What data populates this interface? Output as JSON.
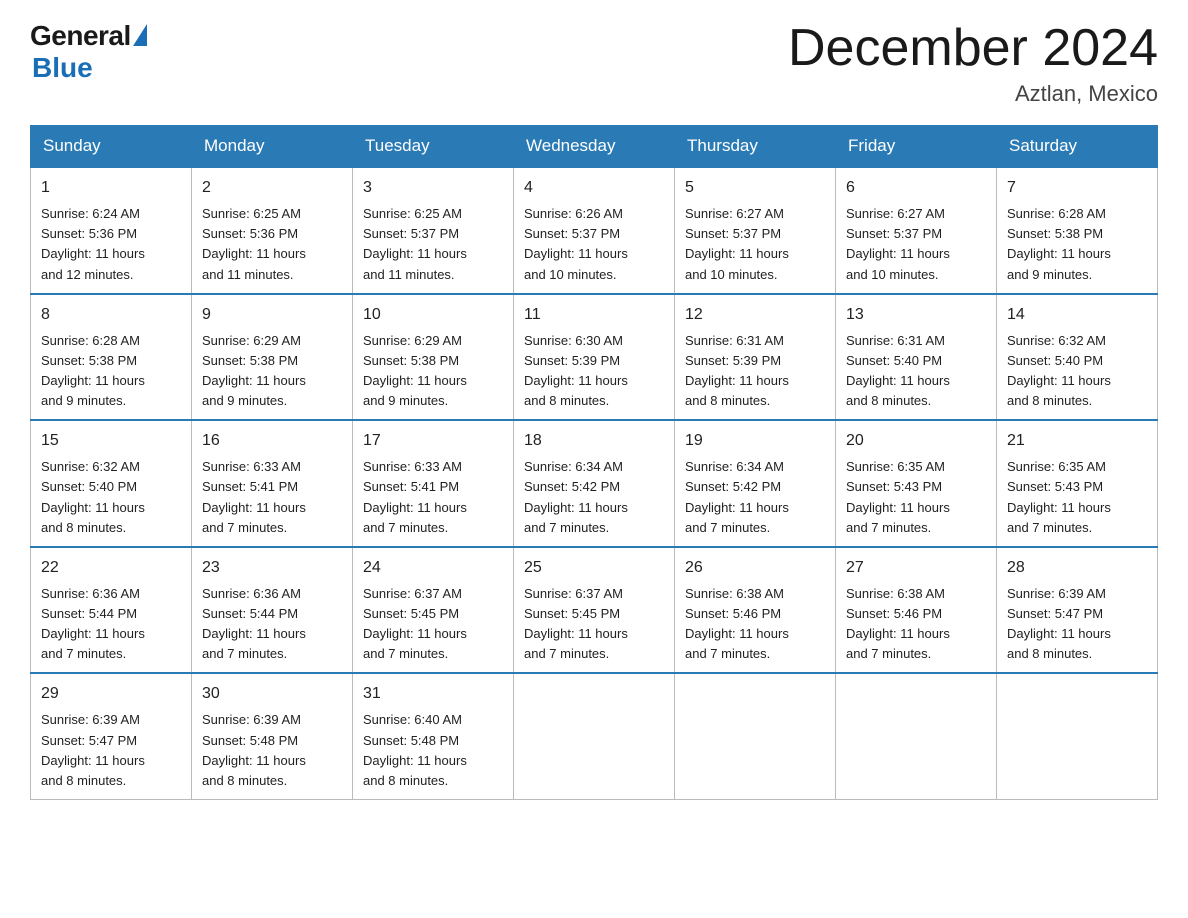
{
  "header": {
    "logo_general": "General",
    "logo_blue": "Blue",
    "month_title": "December 2024",
    "location": "Aztlan, Mexico"
  },
  "calendar": {
    "days_of_week": [
      "Sunday",
      "Monday",
      "Tuesday",
      "Wednesday",
      "Thursday",
      "Friday",
      "Saturday"
    ],
    "weeks": [
      [
        {
          "day": "1",
          "sunrise": "6:24 AM",
          "sunset": "5:36 PM",
          "daylight": "11 hours and 12 minutes."
        },
        {
          "day": "2",
          "sunrise": "6:25 AM",
          "sunset": "5:36 PM",
          "daylight": "11 hours and 11 minutes."
        },
        {
          "day": "3",
          "sunrise": "6:25 AM",
          "sunset": "5:37 PM",
          "daylight": "11 hours and 11 minutes."
        },
        {
          "day": "4",
          "sunrise": "6:26 AM",
          "sunset": "5:37 PM",
          "daylight": "11 hours and 10 minutes."
        },
        {
          "day": "5",
          "sunrise": "6:27 AM",
          "sunset": "5:37 PM",
          "daylight": "11 hours and 10 minutes."
        },
        {
          "day": "6",
          "sunrise": "6:27 AM",
          "sunset": "5:37 PM",
          "daylight": "11 hours and 10 minutes."
        },
        {
          "day": "7",
          "sunrise": "6:28 AM",
          "sunset": "5:38 PM",
          "daylight": "11 hours and 9 minutes."
        }
      ],
      [
        {
          "day": "8",
          "sunrise": "6:28 AM",
          "sunset": "5:38 PM",
          "daylight": "11 hours and 9 minutes."
        },
        {
          "day": "9",
          "sunrise": "6:29 AM",
          "sunset": "5:38 PM",
          "daylight": "11 hours and 9 minutes."
        },
        {
          "day": "10",
          "sunrise": "6:29 AM",
          "sunset": "5:38 PM",
          "daylight": "11 hours and 9 minutes."
        },
        {
          "day": "11",
          "sunrise": "6:30 AM",
          "sunset": "5:39 PM",
          "daylight": "11 hours and 8 minutes."
        },
        {
          "day": "12",
          "sunrise": "6:31 AM",
          "sunset": "5:39 PM",
          "daylight": "11 hours and 8 minutes."
        },
        {
          "day": "13",
          "sunrise": "6:31 AM",
          "sunset": "5:40 PM",
          "daylight": "11 hours and 8 minutes."
        },
        {
          "day": "14",
          "sunrise": "6:32 AM",
          "sunset": "5:40 PM",
          "daylight": "11 hours and 8 minutes."
        }
      ],
      [
        {
          "day": "15",
          "sunrise": "6:32 AM",
          "sunset": "5:40 PM",
          "daylight": "11 hours and 8 minutes."
        },
        {
          "day": "16",
          "sunrise": "6:33 AM",
          "sunset": "5:41 PM",
          "daylight": "11 hours and 7 minutes."
        },
        {
          "day": "17",
          "sunrise": "6:33 AM",
          "sunset": "5:41 PM",
          "daylight": "11 hours and 7 minutes."
        },
        {
          "day": "18",
          "sunrise": "6:34 AM",
          "sunset": "5:42 PM",
          "daylight": "11 hours and 7 minutes."
        },
        {
          "day": "19",
          "sunrise": "6:34 AM",
          "sunset": "5:42 PM",
          "daylight": "11 hours and 7 minutes."
        },
        {
          "day": "20",
          "sunrise": "6:35 AM",
          "sunset": "5:43 PM",
          "daylight": "11 hours and 7 minutes."
        },
        {
          "day": "21",
          "sunrise": "6:35 AM",
          "sunset": "5:43 PM",
          "daylight": "11 hours and 7 minutes."
        }
      ],
      [
        {
          "day": "22",
          "sunrise": "6:36 AM",
          "sunset": "5:44 PM",
          "daylight": "11 hours and 7 minutes."
        },
        {
          "day": "23",
          "sunrise": "6:36 AM",
          "sunset": "5:44 PM",
          "daylight": "11 hours and 7 minutes."
        },
        {
          "day": "24",
          "sunrise": "6:37 AM",
          "sunset": "5:45 PM",
          "daylight": "11 hours and 7 minutes."
        },
        {
          "day": "25",
          "sunrise": "6:37 AM",
          "sunset": "5:45 PM",
          "daylight": "11 hours and 7 minutes."
        },
        {
          "day": "26",
          "sunrise": "6:38 AM",
          "sunset": "5:46 PM",
          "daylight": "11 hours and 7 minutes."
        },
        {
          "day": "27",
          "sunrise": "6:38 AM",
          "sunset": "5:46 PM",
          "daylight": "11 hours and 7 minutes."
        },
        {
          "day": "28",
          "sunrise": "6:39 AM",
          "sunset": "5:47 PM",
          "daylight": "11 hours and 8 minutes."
        }
      ],
      [
        {
          "day": "29",
          "sunrise": "6:39 AM",
          "sunset": "5:47 PM",
          "daylight": "11 hours and 8 minutes."
        },
        {
          "day": "30",
          "sunrise": "6:39 AM",
          "sunset": "5:48 PM",
          "daylight": "11 hours and 8 minutes."
        },
        {
          "day": "31",
          "sunrise": "6:40 AM",
          "sunset": "5:48 PM",
          "daylight": "11 hours and 8 minutes."
        },
        null,
        null,
        null,
        null
      ]
    ],
    "sunrise_label": "Sunrise:",
    "sunset_label": "Sunset:",
    "daylight_label": "Daylight:"
  }
}
